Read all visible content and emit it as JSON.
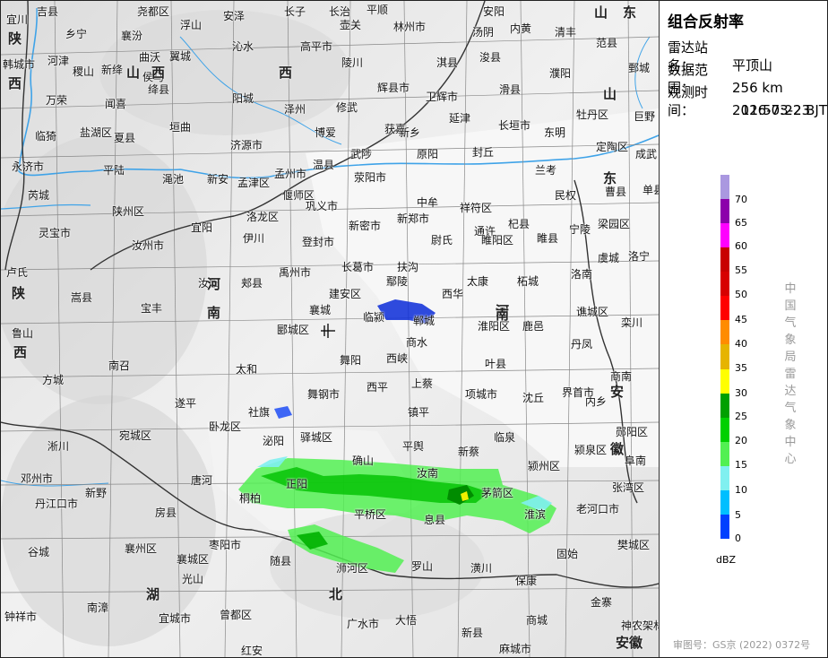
{
  "panel": {
    "title": "组合反射率",
    "station_label": "雷达站名：",
    "station_value": "平顶山",
    "range_label": "数据范围：",
    "range_value": "256 km",
    "time_label": "观测时间：",
    "time_date": "2026-03-23",
    "time_clock": "11:57:22 BJT",
    "legend_unit": "dBZ",
    "agency": "中国气象局雷达气象中心",
    "review_no": "审图号：GS京 (2022) 0372号"
  },
  "legend": {
    "colors": [
      "#aa98e0",
      "#8c00ab",
      "#ff00ff",
      "#c80000",
      "#d70000",
      "#ff0000",
      "#ff8c00",
      "#e6b400",
      "#ffff00",
      "#00a000",
      "#00d000",
      "#52f052",
      "#80f0f0",
      "#00bfff",
      "#0040ff"
    ],
    "ticks": [
      "70",
      "65",
      "60",
      "55",
      "50",
      "45",
      "40",
      "35",
      "30",
      "25",
      "20",
      "15",
      "10",
      "5",
      "0"
    ]
  },
  "places": [
    {
      "t": "宜川"
    },
    {
      "t": "吉县"
    },
    {
      "t": "尧都区"
    },
    {
      "t": "浮山"
    },
    {
      "t": "安泽"
    },
    {
      "t": "长子"
    },
    {
      "t": "长治"
    },
    {
      "t": "壶关"
    },
    {
      "t": "平顺"
    },
    {
      "t": "林州市"
    },
    {
      "t": "安阳"
    },
    {
      "t": "内黄"
    },
    {
      "t": "清丰"
    },
    {
      "t": "乡宁"
    },
    {
      "t": "襄汾"
    },
    {
      "t": "翼城"
    },
    {
      "t": "沁水"
    },
    {
      "t": "高平市"
    },
    {
      "t": "陵川"
    },
    {
      "t": "淇县"
    },
    {
      "t": "汤阴"
    },
    {
      "t": "浚县"
    },
    {
      "t": "滑县"
    },
    {
      "t": "濮阳"
    },
    {
      "t": "范县"
    },
    {
      "t": "鄄城"
    },
    {
      "t": "韩城市"
    },
    {
      "t": "河津"
    },
    {
      "t": "稷山"
    },
    {
      "t": "新绛"
    },
    {
      "t": "曲沃"
    },
    {
      "t": "侯马"
    },
    {
      "t": "绛县"
    },
    {
      "t": "阳城"
    },
    {
      "t": "泽州"
    },
    {
      "t": "辉县市"
    },
    {
      "t": "卫辉市"
    },
    {
      "t": "延津"
    },
    {
      "t": "长垣市"
    },
    {
      "t": "东明"
    },
    {
      "t": "牡丹区"
    },
    {
      "t": "巨野"
    },
    {
      "t": "万荣"
    },
    {
      "t": "闻喜"
    },
    {
      "t": "垣曲"
    },
    {
      "t": "济源市"
    },
    {
      "t": "博爱"
    },
    {
      "t": "修武"
    },
    {
      "t": "获嘉"
    },
    {
      "t": "新乡"
    },
    {
      "t": "原阳"
    },
    {
      "t": "封丘"
    },
    {
      "t": "兰考"
    },
    {
      "t": "定陶区"
    },
    {
      "t": "成武"
    },
    {
      "t": "临猗"
    },
    {
      "t": "盐湖区"
    },
    {
      "t": "夏县"
    },
    {
      "t": "温县"
    },
    {
      "t": "武陟"
    },
    {
      "t": "孟州市"
    },
    {
      "t": "永济市"
    },
    {
      "t": "平陆"
    },
    {
      "t": "渑池"
    },
    {
      "t": "新安"
    },
    {
      "t": "孟津区"
    },
    {
      "t": "荥阳市"
    },
    {
      "t": "中牟"
    },
    {
      "t": "民权"
    },
    {
      "t": "曹县"
    },
    {
      "t": "单县"
    },
    {
      "t": "芮城"
    },
    {
      "t": "陕州区"
    },
    {
      "t": "偃师区"
    },
    {
      "t": "巩义市"
    },
    {
      "t": "新密市"
    },
    {
      "t": "新郑市"
    },
    {
      "t": "祥符区"
    },
    {
      "t": "杞县"
    },
    {
      "t": "睢县"
    },
    {
      "t": "宁陵"
    },
    {
      "t": "梁园区"
    },
    {
      "t": "灵宝市"
    },
    {
      "t": "宜阳"
    },
    {
      "t": "洛龙区"
    },
    {
      "t": "伊川"
    },
    {
      "t": "登封市"
    },
    {
      "t": "尉氏"
    },
    {
      "t": "通许"
    },
    {
      "t": "睢阳区"
    },
    {
      "t": "虞城"
    },
    {
      "t": "洛宁"
    },
    {
      "t": "汝州市"
    },
    {
      "t": "禹州市"
    },
    {
      "t": "长葛市"
    },
    {
      "t": "扶沟"
    },
    {
      "t": "太康"
    },
    {
      "t": "柘城"
    },
    {
      "t": "洛南"
    },
    {
      "t": "卢氏"
    },
    {
      "t": "嵩县"
    },
    {
      "t": "汝阳"
    },
    {
      "t": "郏县"
    },
    {
      "t": "建安区"
    },
    {
      "t": "鄢陵"
    },
    {
      "t": "西华"
    },
    {
      "t": "淮阳区"
    },
    {
      "t": "鹿邑"
    },
    {
      "t": "谯城区"
    },
    {
      "t": "栾川"
    },
    {
      "t": "宝丰"
    },
    {
      "t": "襄城"
    },
    {
      "t": "临颍"
    },
    {
      "t": "郸城"
    },
    {
      "t": "丹凤"
    },
    {
      "t": "鲁山"
    },
    {
      "t": "郾城区"
    },
    {
      "t": "商水"
    },
    {
      "t": "叶县"
    },
    {
      "t": "舞阳"
    },
    {
      "t": "西峡"
    },
    {
      "t": "南召"
    },
    {
      "t": "太和"
    },
    {
      "t": "商南"
    },
    {
      "t": "方城"
    },
    {
      "t": "舞钢市"
    },
    {
      "t": "西平"
    },
    {
      "t": "上蔡"
    },
    {
      "t": "项城市"
    },
    {
      "t": "沈丘"
    },
    {
      "t": "界首市"
    },
    {
      "t": "内乡"
    },
    {
      "t": "遂平"
    },
    {
      "t": "镇平"
    },
    {
      "t": "卧龙区"
    },
    {
      "t": "社旗"
    },
    {
      "t": "驿城区"
    },
    {
      "t": "平舆"
    },
    {
      "t": "临泉"
    },
    {
      "t": "颍泉区"
    },
    {
      "t": "郧阳区"
    },
    {
      "t": "淅川"
    },
    {
      "t": "宛城区"
    },
    {
      "t": "泌阳"
    },
    {
      "t": "确山"
    },
    {
      "t": "汝南"
    },
    {
      "t": "新蔡"
    },
    {
      "t": "颍州区"
    },
    {
      "t": "阜南"
    },
    {
      "t": "张湾区"
    },
    {
      "t": "邓州市"
    },
    {
      "t": "唐河"
    },
    {
      "t": "正阳"
    },
    {
      "t": "茅箭区"
    },
    {
      "t": "丹江口市"
    },
    {
      "t": "新野"
    },
    {
      "t": "桐柏"
    },
    {
      "t": "平桥区"
    },
    {
      "t": "息县"
    },
    {
      "t": "淮滨"
    },
    {
      "t": "老河口市"
    },
    {
      "t": "房县"
    },
    {
      "t": "谷城"
    },
    {
      "t": "襄州区"
    },
    {
      "t": "枣阳市"
    },
    {
      "t": "随县"
    },
    {
      "t": "浉河区"
    },
    {
      "t": "罗山"
    },
    {
      "t": "潢川"
    },
    {
      "t": "固始"
    },
    {
      "t": "樊城区"
    },
    {
      "t": "襄城区"
    },
    {
      "t": "光山"
    },
    {
      "t": "保康"
    },
    {
      "t": "南漳"
    },
    {
      "t": "宜城市"
    },
    {
      "t": "曾都区"
    },
    {
      "t": "广水市"
    },
    {
      "t": "大悟"
    },
    {
      "t": "新县"
    },
    {
      "t": "商城"
    },
    {
      "t": "金寨"
    },
    {
      "t": "神农架林区"
    },
    {
      "t": "钟祥市"
    },
    {
      "t": "红安"
    },
    {
      "t": "麻城市"
    }
  ],
  "provinces": [
    "山",
    "西",
    "陕",
    "西",
    "山",
    "西",
    "河",
    "南",
    "东",
    "山",
    "东",
    "陕",
    "西",
    "湖",
    "北",
    "河",
    "南",
    "安",
    "徽",
    "安徽"
  ]
}
